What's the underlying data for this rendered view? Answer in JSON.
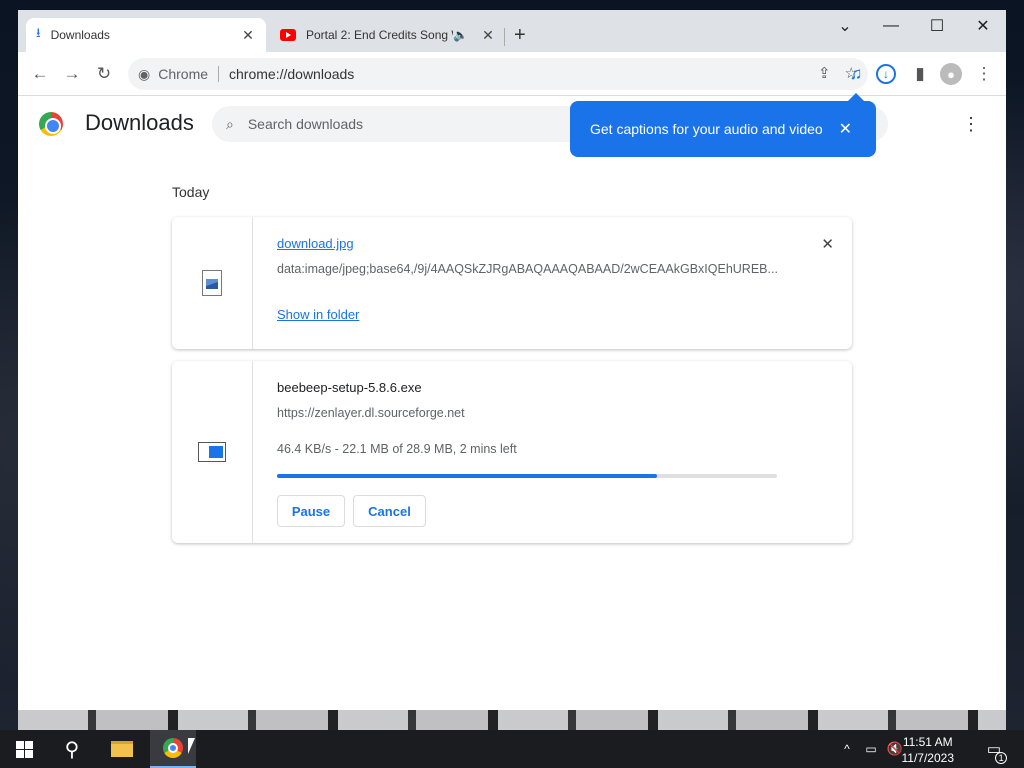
{
  "window": {
    "tabs": [
      {
        "label": "Downloads",
        "icon": "download-icon"
      },
      {
        "label": "Portal 2: End Credits Song W",
        "icon": "youtube-icon"
      }
    ],
    "controls": {
      "dropdown": "⌄",
      "minimize": "—",
      "maximize": "☐",
      "close": "✕"
    }
  },
  "toolbar": {
    "chip_label": "Chrome",
    "url": "chrome://downloads"
  },
  "page": {
    "title": "Downloads",
    "search_placeholder": "Search downloads",
    "section": "Today"
  },
  "bubble": {
    "text": "Get captions for your audio and video"
  },
  "downloads": [
    {
      "filename": "download.jpg",
      "url": "data:image/jpeg;base64,/9j/4AAQSkZJRgABAQAAAQABAAD/2wCEAAkGBxIQEhUREB...",
      "action": "Show in folder"
    },
    {
      "filename": "beebeep-setup-5.8.6.exe",
      "url": "https://zenlayer.dl.sourceforge.net",
      "status": "46.4 KB/s - 22.1 MB of 28.9 MB, 2 mins left",
      "progress_fraction": 0.76,
      "pause_label": "Pause",
      "cancel_label": "Cancel"
    }
  ],
  "taskbar": {
    "time": "11:51 AM",
    "date": "11/7/2023",
    "notifications": "1"
  },
  "colors": {
    "accent": "#1a73e8"
  }
}
